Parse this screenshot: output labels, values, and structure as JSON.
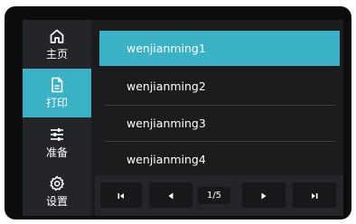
{
  "sidebar": {
    "items": [
      {
        "label": "主页",
        "icon": "home-icon",
        "active": false
      },
      {
        "label": "打印",
        "icon": "print-file-icon",
        "active": true
      },
      {
        "label": "准备",
        "icon": "sliders-icon",
        "active": false
      },
      {
        "label": "设置",
        "icon": "gear-icon",
        "active": false
      }
    ]
  },
  "files": {
    "items": [
      {
        "name": "wenjianming1",
        "selected": true
      },
      {
        "name": "wenjianming2",
        "selected": false
      },
      {
        "name": "wenjianming3",
        "selected": false
      },
      {
        "name": "wenjianming4",
        "selected": false
      }
    ]
  },
  "pager": {
    "page_text": "1/5",
    "buttons": [
      "first-page-icon",
      "prev-page-icon",
      "next-page-icon",
      "last-page-icon"
    ]
  },
  "colors": {
    "accent": "#3ab1c5",
    "frame": "#0c0c0d",
    "panel": "#242528",
    "background": "#1c1c1e"
  }
}
